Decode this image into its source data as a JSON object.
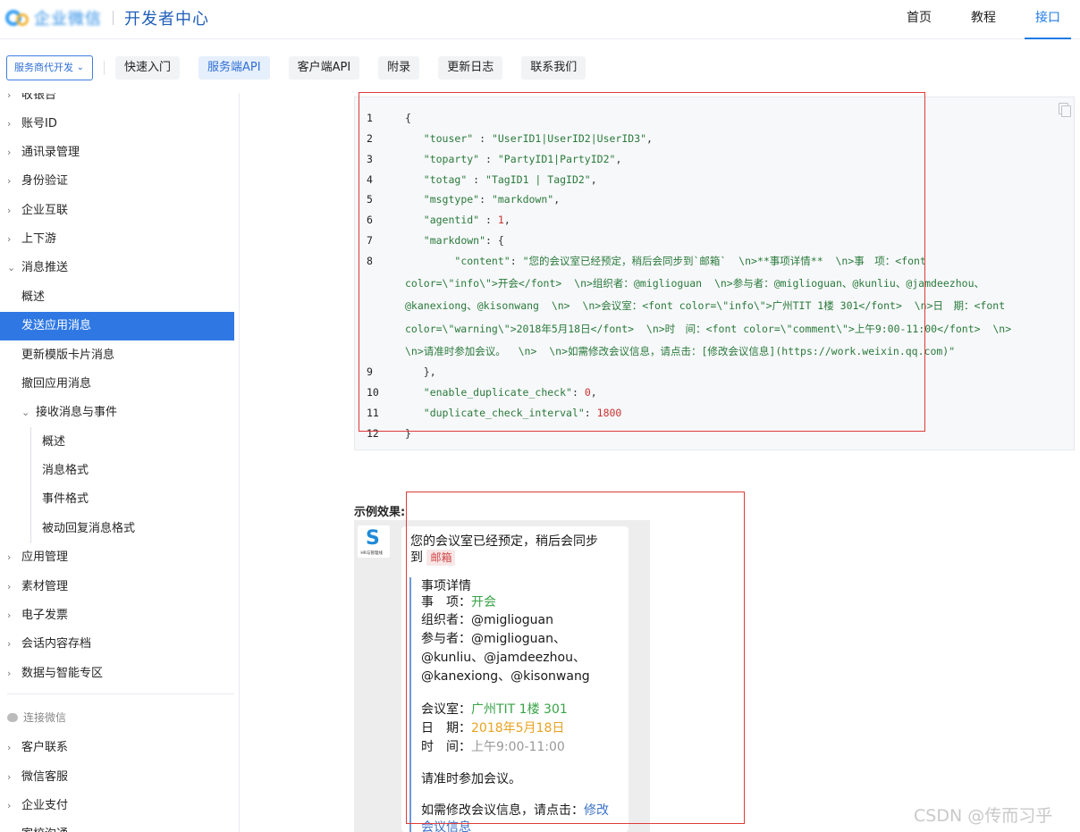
{
  "header": {
    "logo_text": "企业微信",
    "title": "开发者中心",
    "nav": [
      "首页",
      "教程",
      "接口"
    ]
  },
  "subnav": {
    "select_label": "服务商代开发",
    "tabs": [
      "快速入门",
      "服务端API",
      "客户端API",
      "附录",
      "更新日志",
      "联系我们"
    ]
  },
  "sidebar": {
    "items": [
      "收银台",
      "账号ID",
      "通讯录管理",
      "身份验证",
      "企业互联",
      "上下游",
      "消息推送",
      "概述",
      "发送应用消息",
      "更新模版卡片消息",
      "撤回应用消息",
      "接收消息与事件",
      "概述",
      "消息格式",
      "事件格式",
      "被动回复消息格式",
      "应用管理",
      "素材管理",
      "电子发票",
      "会话内容存档",
      "数据与智能专区"
    ],
    "group_label": "连接微信",
    "group_items": [
      "客户联系",
      "微信客服",
      "企业支付",
      "家校沟通"
    ]
  },
  "code": {
    "line_numbers": [
      "1",
      "2",
      "3",
      "4",
      "5",
      "6",
      "7",
      "8",
      "9",
      "10",
      "11",
      "12"
    ],
    "touser_key": "\"touser\"",
    "touser_val": "\"UserID1|UserID2|UserID3\"",
    "toparty_key": "\"toparty\"",
    "toparty_val": "\"PartyID1|PartyID2\"",
    "totag_key": "\"totag\"",
    "totag_val": "\"TagID1 | TagID2\"",
    "msgtype_key": "\"msgtype\"",
    "msgtype_val": "\"markdown\"",
    "agentid_key": "\"agentid\"",
    "agentid_val": "1",
    "markdown_key": "\"markdown\"",
    "content_key": "\"content\"",
    "content_l1": "\"您的会议室已经预定，稍后会同步到`邮箱`  \\n>**事项详情**  \\n>事　项：<font",
    "content_l2": "color=\\\"info\\\">开会</font>  \\n>组织者：@miglioguan  \\n>参与者：@miglioguan、@kunliu、@jamdeezhou、",
    "content_l3": "@kanexiong、@kisonwang  \\n>  \\n>会议室：<font color=\\\"info\\\">广州TIT 1楼 301</font>  \\n>日　期：<font",
    "content_l4": "color=\\\"warning\\\">2018年5月18日</font>  \\n>时　间：<font color=\\\"comment\\\">上午9:00-11:00</font>  \\n>",
    "content_l5": "\\n>请准时参加会议。  \\n>  \\n>如需修改会议信息，请点击：[修改会议信息](https://work.weixin.qq.com)\"",
    "enable_key": "\"enable_duplicate_check\"",
    "enable_val": "0",
    "interval_key": "\"duplicate_check_interval\"",
    "interval_val": "1800"
  },
  "example": {
    "label": "示例效果:",
    "avatar_logo": "HR与管理线",
    "line1": "您的会议室已经预定，稍后会同步",
    "line2_prefix": "到",
    "mail_tag": "邮箱",
    "detail_title": "事项详情",
    "item_label": "事　项：",
    "item_value": "开会",
    "organizer": "组织者：@miglioguan",
    "participants1": "参与者：@miglioguan、",
    "participants2": "@kunliu、@jamdeezhou、",
    "participants3": "@kanexiong、@kisonwang",
    "room_label": "会议室：",
    "room_value": "广州TIT 1楼 301",
    "date_label": "日　期：",
    "date_value": "2018年5月18日",
    "time_label": "时　间：",
    "time_value": "上午9:00-11:00",
    "reminder": "请准时参加会议。",
    "modify_prefix": "如需修改会议信息，请点击：",
    "modify_link1": "修改",
    "modify_link2": "会议信息"
  },
  "colors": {
    "accent": "#2f78e4",
    "info": "#38a347",
    "warning": "#e8a321",
    "comment": "#999999",
    "annotation": "#e03a3a"
  },
  "watermark": "CSDN @传而习乎"
}
